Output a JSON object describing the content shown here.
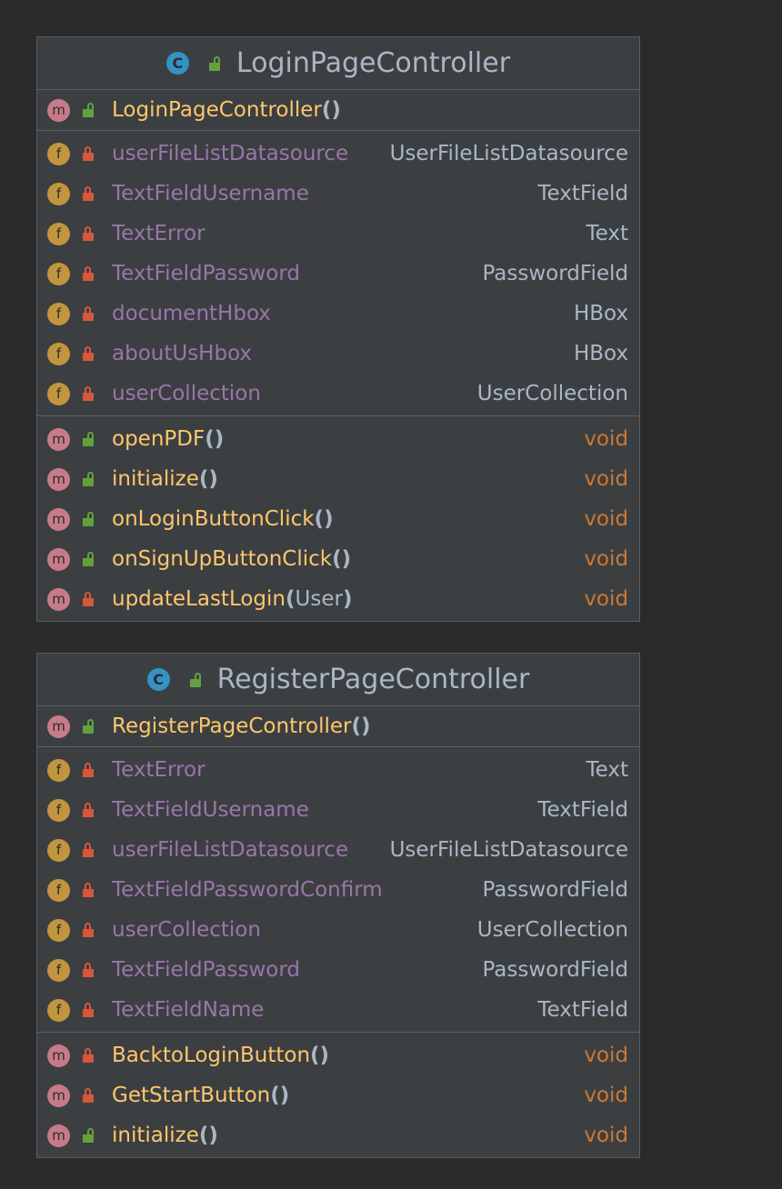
{
  "classes": [
    {
      "name": "LoginPageController",
      "class_icon": "C",
      "constructor": {
        "name": "LoginPageController",
        "params": "",
        "visibility": "public"
      },
      "fields": [
        {
          "name": "userFileListDatasource",
          "type": "UserFileListDatasource"
        },
        {
          "name": "TextFieldUsername",
          "type": "TextField"
        },
        {
          "name": "TextError",
          "type": "Text"
        },
        {
          "name": "TextFieldPassword",
          "type": "PasswordField"
        },
        {
          "name": "documentHbox",
          "type": "HBox"
        },
        {
          "name": "aboutUsHbox",
          "type": "HBox"
        },
        {
          "name": "userCollection",
          "type": "UserCollection"
        }
      ],
      "methods": [
        {
          "name": "openPDF",
          "params": "",
          "type": "void",
          "visibility": "public"
        },
        {
          "name": "initialize",
          "params": "",
          "type": "void",
          "visibility": "public"
        },
        {
          "name": "onLoginButtonClick",
          "params": "",
          "type": "void",
          "visibility": "public"
        },
        {
          "name": "onSignUpButtonClick",
          "params": "",
          "type": "void",
          "visibility": "public"
        },
        {
          "name": "updateLastLogin",
          "params": "User",
          "type": "void",
          "visibility": "private"
        }
      ]
    },
    {
      "name": "RegisterPageController",
      "class_icon": "C",
      "constructor": {
        "name": "RegisterPageController",
        "params": "",
        "visibility": "public"
      },
      "fields": [
        {
          "name": "TextError",
          "type": "Text"
        },
        {
          "name": "TextFieldUsername",
          "type": "TextField"
        },
        {
          "name": "userFileListDatasource",
          "type": "UserFileListDatasource"
        },
        {
          "name": "TextFieldPasswordConfirm",
          "type": "PasswordField"
        },
        {
          "name": "userCollection",
          "type": "UserCollection"
        },
        {
          "name": "TextFieldPassword",
          "type": "PasswordField"
        },
        {
          "name": "TextFieldName",
          "type": "TextField"
        }
      ],
      "methods": [
        {
          "name": "BacktoLoginButton",
          "params": "",
          "type": "void",
          "visibility": "private"
        },
        {
          "name": "GetStartButton",
          "params": "",
          "type": "void",
          "visibility": "private"
        },
        {
          "name": "initialize",
          "params": "",
          "type": "void",
          "visibility": "public"
        }
      ]
    }
  ],
  "badges": {
    "method": "m",
    "field": "f"
  },
  "colors": {
    "background": "#2b2b2c",
    "panel": "#3c3f41",
    "field_name": "#9876aa",
    "method_name": "#ffc66d",
    "return_type": "#cc7832",
    "text": "#a9b7c6",
    "private_lock": "#d7573c",
    "public_lock": "#62a23e"
  }
}
